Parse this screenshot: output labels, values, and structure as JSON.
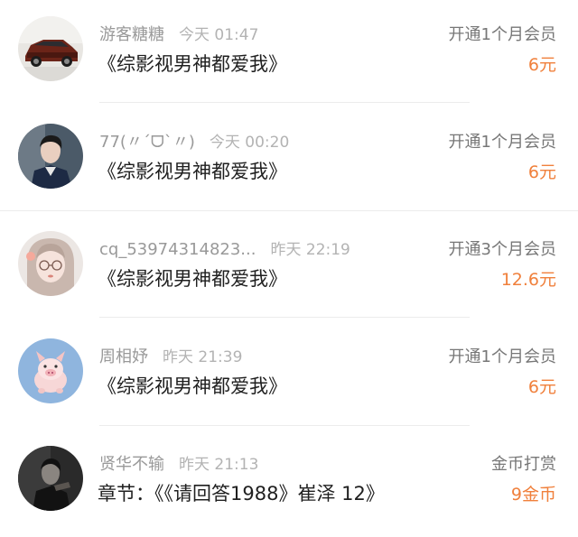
{
  "colors": {
    "amount": "#f0803c",
    "username": "#999999",
    "title": "#1f1f1f",
    "action": "#777777",
    "divider": "#ececec"
  },
  "items": [
    {
      "username": "游客糖糖",
      "time": "今天 01:47",
      "title": "《综影视男神都爱我》",
      "action": "开通1个月会员",
      "amount": "6元",
      "avatar": "car-avatar-icon"
    },
    {
      "username": "77(〃ˊᗜˋ〃)",
      "time": "今天 00:20",
      "title": "《综影视男神都爱我》",
      "action": "开通1个月会员",
      "amount": "6元",
      "avatar": "man-portrait-avatar-icon"
    },
    {
      "username": "cq_53974314823...",
      "time": "昨天 22:19",
      "title": "《综影视男神都爱我》",
      "action": "开通3个月会员",
      "amount": "12.6元",
      "avatar": "girl-glasses-avatar-icon"
    },
    {
      "username": "周相妤",
      "time": "昨天 21:39",
      "title": "《综影视男神都爱我》",
      "action": "开通1个月会员",
      "amount": "6元",
      "avatar": "pig-avatar-icon"
    },
    {
      "username": "贤华不输",
      "time": "昨天 21:13",
      "title": "章节：《《请回答1988》崔泽 12》",
      "action": "金币打赏",
      "amount": "9金币",
      "avatar": "dark-portrait-avatar-icon"
    }
  ]
}
